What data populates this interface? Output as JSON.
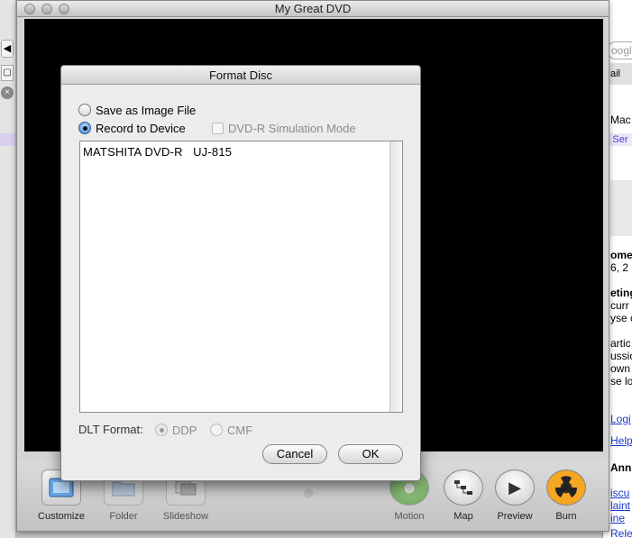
{
  "main_window": {
    "title": "My Great DVD"
  },
  "dialog": {
    "title": "Format Disc",
    "save_image_label": "Save as Image File",
    "record_device_label": "Record to Device",
    "simulation_label": "DVD-R Simulation Mode",
    "devices": [
      "MATSHITA DVD-R   UJ-815"
    ],
    "dlt_label": "DLT Format:",
    "ddp_label": "DDP",
    "cmf_label": "CMF",
    "cancel_label": "Cancel",
    "ok_label": "OK"
  },
  "toolbar": {
    "customize": "Customize",
    "folder": "Folder",
    "slideshow": "Slideshow",
    "motion": "Motion",
    "map": "Map",
    "preview": "Preview",
    "burn": "Burn"
  },
  "background": {
    "search_fragment": "oogle",
    "toolbar_fragment": "ail",
    "purple_fragment": "& Ser",
    "text_fragments": [
      "Mac",
      "ome",
      "6, 2",
      "eting",
      "curr",
      "yse c",
      "artic",
      "ussio",
      "own",
      "se lo"
    ],
    "link_fragments": [
      "Logi",
      "Help"
    ],
    "heading_fragment": "Ann",
    "bottom_links": [
      "iscu",
      "laint",
      "ine",
      "Relea"
    ]
  },
  "colors": {
    "accent": "#3b7ed6",
    "link": "#1a3ad0",
    "viewer": "#000000"
  }
}
